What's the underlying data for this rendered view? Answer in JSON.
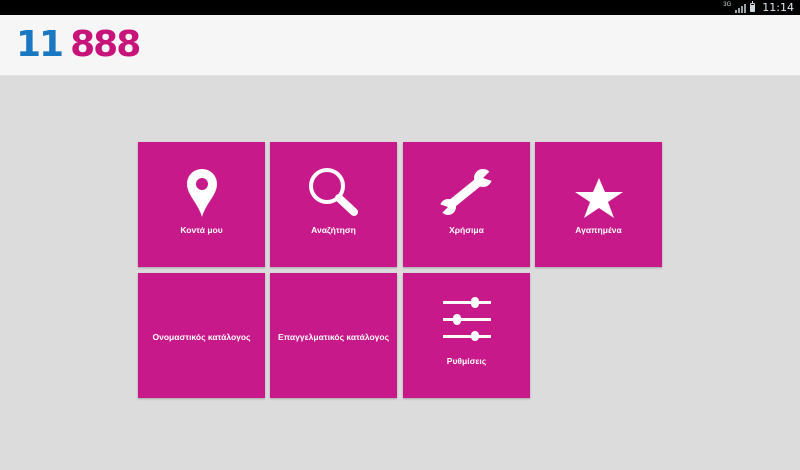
{
  "status": {
    "network": "3G",
    "time": "11:14",
    "battery_level": 0.9
  },
  "app": {
    "logo_part1": "11",
    "logo_part2": "888",
    "logo_color_blue": "#1a77c2",
    "logo_color_pink": "#c8137b"
  },
  "tiles": [
    {
      "label": "Κοντά μου",
      "icon": "location-pin-icon"
    },
    {
      "label": "Αναζήτηση",
      "icon": "search-icon"
    },
    {
      "label": "Χρήσιμα",
      "icon": "wrench-icon"
    },
    {
      "label": "Αγαπημένα",
      "icon": "star-icon"
    },
    {
      "label": "Ονομαστικός κατάλογος",
      "icon": ""
    },
    {
      "label": "Επαγγελματικός κατάλογος",
      "icon": ""
    },
    {
      "label": "Ρυθμίσεις",
      "icon": "sliders-icon"
    }
  ],
  "colors": {
    "tile": "#c8198a",
    "background": "#dcdcdc"
  }
}
